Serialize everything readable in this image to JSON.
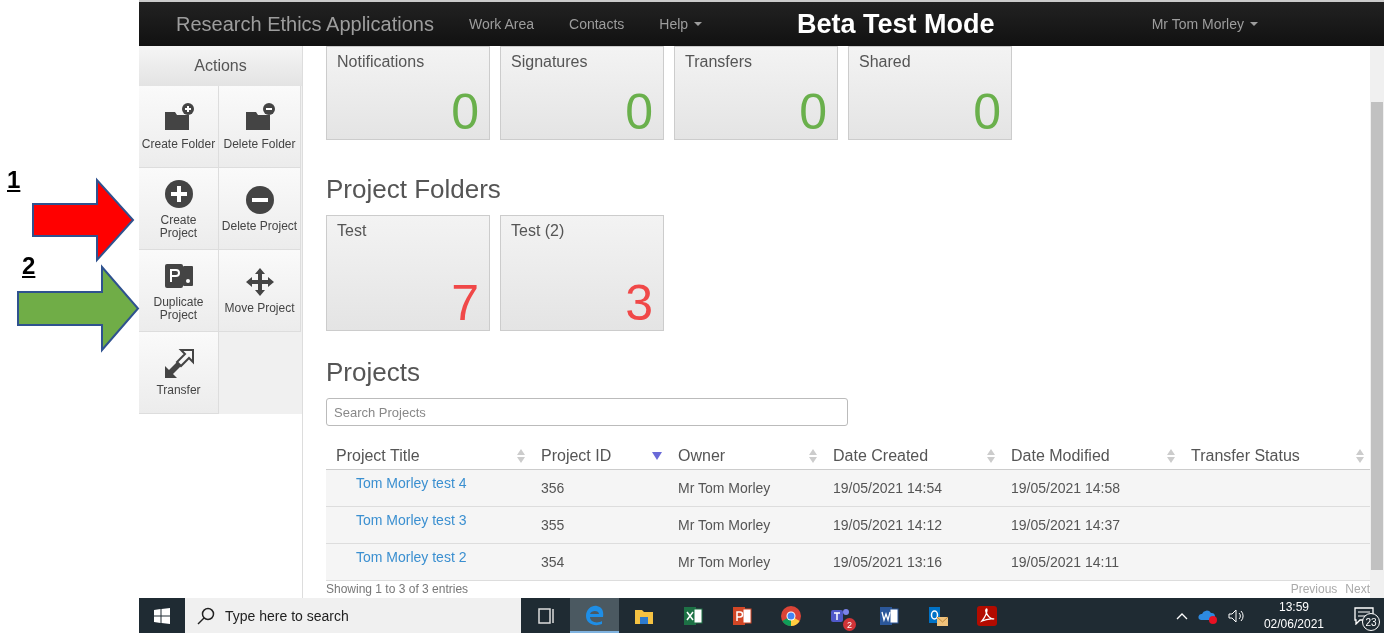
{
  "annotations": [
    {
      "label": "1",
      "color": "#ff0000"
    },
    {
      "label": "2",
      "color": "#70ad47"
    }
  ],
  "navbar": {
    "brand": "Research Ethics Applications",
    "links": [
      {
        "label": "Work Area",
        "dropdown": false
      },
      {
        "label": "Contacts",
        "dropdown": false
      },
      {
        "label": "Help",
        "dropdown": true
      }
    ],
    "banner": "Beta Test Mode",
    "user": {
      "label": "Mr Tom Morley",
      "dropdown": true
    }
  },
  "actions": {
    "title": "Actions",
    "items": [
      {
        "label": "Create Folder",
        "kind": "add_folder"
      },
      {
        "label": "Delete Folder",
        "kind": "delete_folder"
      },
      {
        "label": "Create Project",
        "kind": "add"
      },
      {
        "label": "Delete Project",
        "kind": "delete"
      },
      {
        "label": "Duplicate Project",
        "kind": "duplicate"
      },
      {
        "label": "Move Project",
        "kind": "move"
      },
      {
        "label": "Transfer",
        "kind": "transfer"
      }
    ]
  },
  "stat_cards": [
    {
      "title": "Notifications",
      "count": "0"
    },
    {
      "title": "Signatures",
      "count": "0"
    },
    {
      "title": "Transfers",
      "count": "0"
    },
    {
      "title": "Shared",
      "count": "0"
    }
  ],
  "project_folders": {
    "heading": "Project Folders",
    "folders": [
      {
        "title": "Test",
        "count": "7"
      },
      {
        "title": "Test (2)",
        "count": "3"
      }
    ]
  },
  "projects": {
    "heading": "Projects",
    "search": {
      "placeholder": "Search Projects"
    },
    "columns": [
      {
        "label": "Project Title",
        "sorted": false
      },
      {
        "label": "Project ID",
        "sorted": true
      },
      {
        "label": "Owner",
        "sorted": false
      },
      {
        "label": "Date Created",
        "sorted": false
      },
      {
        "label": "Date Modified",
        "sorted": false
      },
      {
        "label": "Transfer Status",
        "sorted": false
      }
    ],
    "rows": [
      [
        "Tom Morley test 4",
        "356",
        "Mr Tom Morley",
        "19/05/2021 14:54",
        "19/05/2021 14:58",
        ""
      ],
      [
        "Tom Morley test 3",
        "355",
        "Mr Tom Morley",
        "19/05/2021 14:12",
        "19/05/2021 14:37",
        ""
      ],
      [
        "Tom Morley test 2",
        "354",
        "Mr Tom Morley",
        "19/05/2021 13:16",
        "19/05/2021 14:11",
        ""
      ]
    ],
    "info": "Showing 1 to 3 of 3 entries",
    "pagination": [
      "Previous",
      "Next"
    ]
  },
  "taskbar": {
    "search": {
      "placeholder": "Type here to search"
    },
    "apps": [
      {
        "kind": "taskview",
        "selected": false
      },
      {
        "kind": "edge",
        "selected": true
      },
      {
        "kind": "explorer",
        "selected": false
      },
      {
        "kind": "excel",
        "selected": false
      },
      {
        "kind": "powerpoint",
        "selected": false
      },
      {
        "kind": "chrome",
        "selected": false
      },
      {
        "kind": "teams",
        "selected": false,
        "badge": "2"
      },
      {
        "kind": "word",
        "selected": false
      },
      {
        "kind": "outlook",
        "selected": false
      },
      {
        "kind": "acrobat",
        "selected": false
      }
    ],
    "time": "13:59",
    "date": "02/06/2021",
    "notifications": "23"
  }
}
